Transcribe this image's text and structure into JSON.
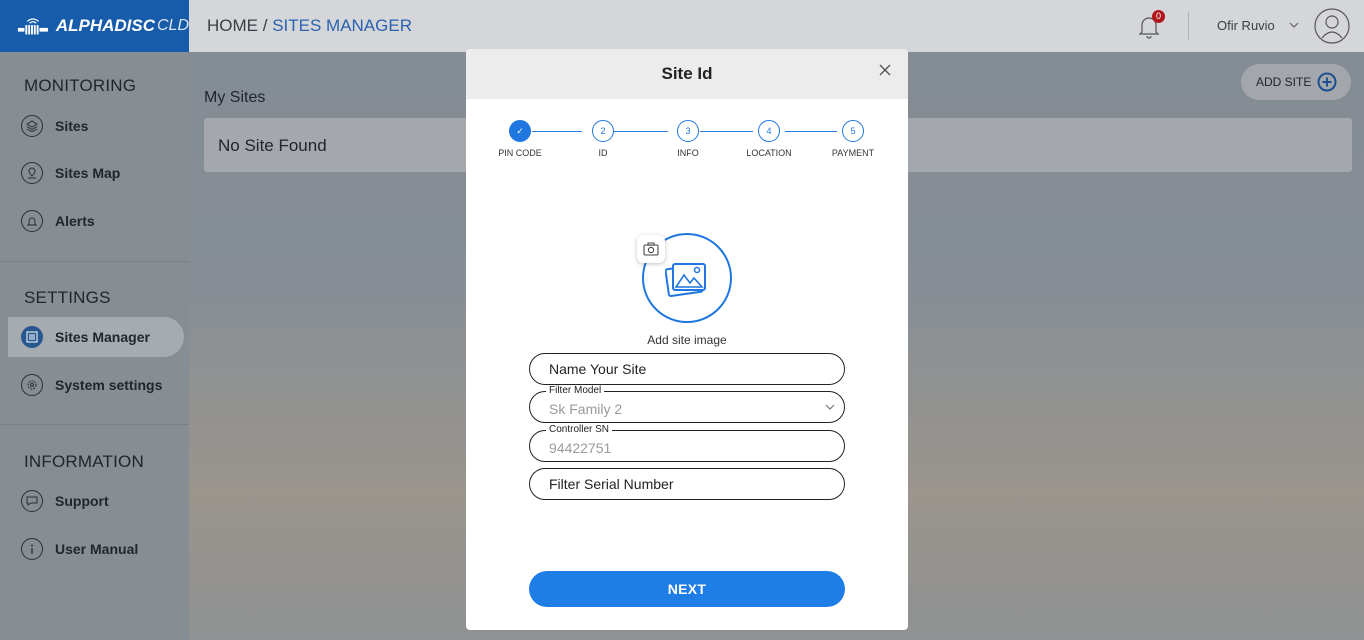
{
  "brand": {
    "bold": "ALPHADISC",
    "light": "CLD"
  },
  "breadcrumb": {
    "home": "HOME /",
    "current": "SITES MANAGER"
  },
  "header": {
    "notifications_count": "0",
    "user_name": "Ofir Ruvio"
  },
  "sidebar": {
    "monitoring_title": "MONITORING",
    "settings_title": "SETTINGS",
    "information_title": "INFORMATION",
    "items": [
      {
        "label": "Sites",
        "icon": "layers-icon"
      },
      {
        "label": "Sites Map",
        "icon": "map-pin-icon"
      },
      {
        "label": "Alerts",
        "icon": "bell-icon"
      },
      {
        "label": "Sites Manager",
        "icon": "sliders-icon",
        "active": true
      },
      {
        "label": "System settings",
        "icon": "gear-icon"
      },
      {
        "label": "Support",
        "icon": "chat-icon"
      },
      {
        "label": "User Manual",
        "icon": "info-icon"
      }
    ]
  },
  "main": {
    "section_title": "My Sites",
    "empty_text": "No Site Found",
    "add_button": "ADD SITE"
  },
  "modal": {
    "title": "Site Id",
    "steps": [
      {
        "number": "✓",
        "label": "PIN CODE",
        "done": true
      },
      {
        "number": "2",
        "label": "ID"
      },
      {
        "number": "3",
        "label": "INFO"
      },
      {
        "number": "4",
        "label": "LOCATION"
      },
      {
        "number": "5",
        "label": "PAYMENT"
      }
    ],
    "image_caption": "Add site image",
    "name_placeholder": "Name Your Site",
    "filter_model": {
      "legend": "Filter Model",
      "value": "Sk Family 2"
    },
    "controller_sn": {
      "legend": "Controller SN",
      "value": "94422751"
    },
    "filter_serial_placeholder": "Filter Serial Number",
    "next_label": "NEXT"
  },
  "colors": {
    "accent": "#1f7de6",
    "brand": "#175bab",
    "badge": "#b0161c"
  }
}
